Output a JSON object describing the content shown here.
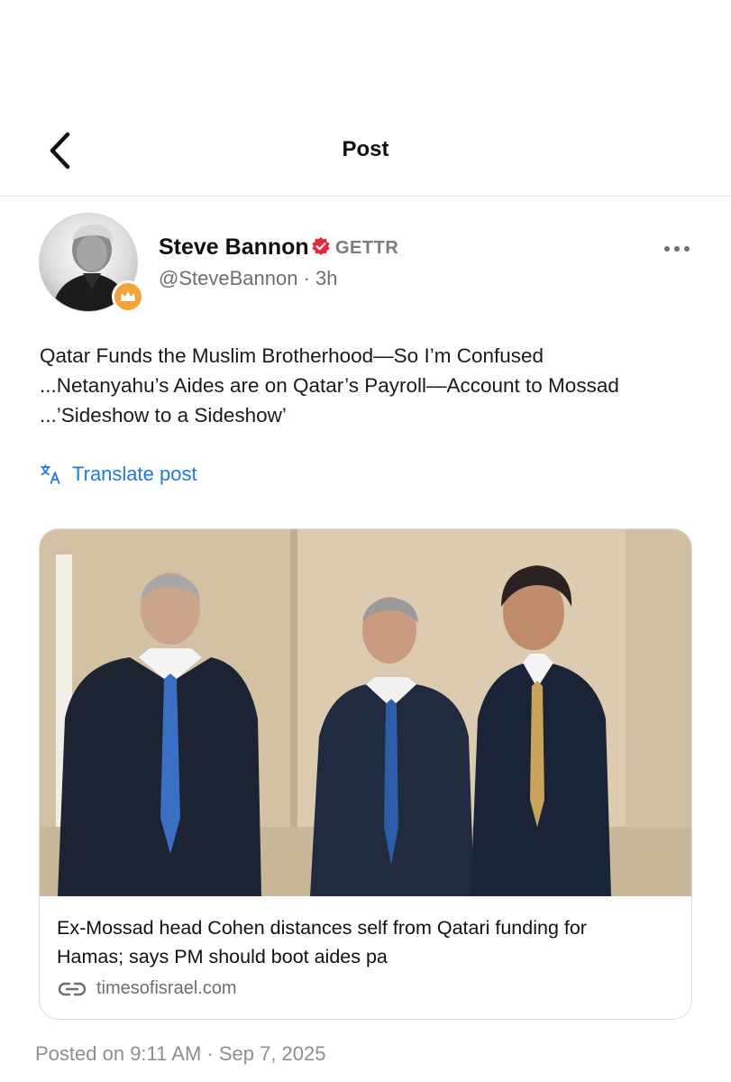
{
  "header": {
    "title": "Post"
  },
  "author": {
    "name": "Steve Bannon",
    "platform_label": "GETTR",
    "handle": "@SteveBannon",
    "age": "3h",
    "separator": "·"
  },
  "post": {
    "lines": [
      "Qatar Funds the Muslim Brotherhood—So I’m Confused",
      "...Netanyahu’s Aides are on Qatar’s Payroll—Account to Mossad",
      "...’Sideshow to a Sideshow’"
    ],
    "translate_label": "Translate post"
  },
  "link_card": {
    "headline_lines": [
      "Ex-Mossad head Cohen distances self from Qatari funding for",
      "Hamas; says PM should boot aides pa"
    ],
    "source": "timesofisrael.com"
  },
  "footer": {
    "posted_on": "Posted on 9:11 AM · Sep 7, 2025"
  },
  "colors": {
    "accent_blue": "#1f7ae0",
    "verified_red": "#e5283a",
    "badge_orange": "#f2a43a",
    "muted_gray": "#6e6e73"
  },
  "icons": {
    "back": "chevron-left-icon",
    "verified": "verified-badge-icon",
    "more": "ellipsis-icon",
    "translate": "translate-icon",
    "link": "link-icon",
    "badge": "crown-icon"
  }
}
